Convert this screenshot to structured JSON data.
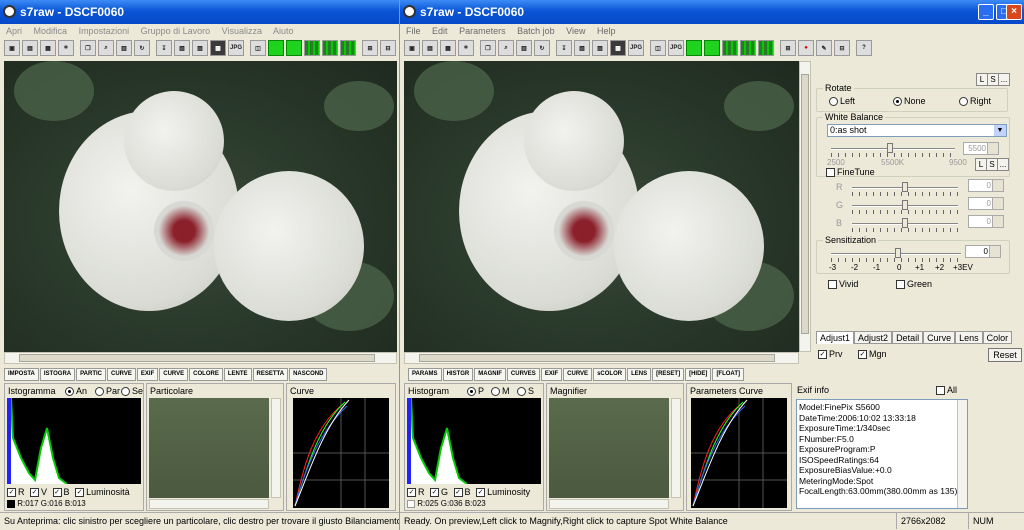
{
  "left_window": {
    "title": "s7raw - DSCF0060",
    "menu": [
      "Apri",
      "Modifica",
      "Impostazioni",
      "Gruppo di Lavoro",
      "Visualizza",
      "Aiuto"
    ],
    "tabs": [
      "IMPOSTA",
      "ISTOGRA",
      "PARTIC",
      "CURVE",
      "EXIF",
      "CURVE",
      "COLORE",
      "LENTE",
      "RESETTA",
      "NASCOND"
    ],
    "histogram_title": "Istogramma",
    "histogram_modes": [
      "An",
      "Par",
      "Se"
    ],
    "detail_title": "Particolare",
    "curve_title": "Curve",
    "channels": [
      "R",
      "V",
      "B",
      "Luminosità"
    ],
    "rgb_readout": "R:017 G:016 B:013",
    "status": "Su Anteprima: clic sinistro per scegliere un particolare, clic destro per trovare il giusto Bilanciamento del"
  },
  "right_window": {
    "title": "s7raw - DSCF0060",
    "menu": [
      "File",
      "Edit",
      "Parameters",
      "Batch job",
      "View",
      "Help"
    ],
    "tabs": [
      "PARAMS",
      "HISTGR",
      "MAGNIF",
      "CURVES",
      "EXIF",
      "CURVE",
      "sCOLOR",
      "LENS",
      "[RESET]",
      "[HIDE]",
      "[FLOAT]"
    ],
    "histogram_title": "Histogram",
    "histogram_modes": [
      "P",
      "M",
      "S"
    ],
    "magnifier_title": "Magnifier",
    "curve_title": "Parameters Curve",
    "exif_title": "Exif info",
    "exif_all": "All",
    "exif_lines": [
      "Model:FinePix S5600",
      "DateTime:2006:10:02 13:33:18",
      "ExposureTime:1/340sec",
      "FNumber:F5.0",
      "ExposureProgram:P",
      "ISOSpeedRatings:64",
      "ExposureBiasValue:+0.0",
      "MeteringMode:Spot",
      "FocalLength:63.00mm(380.00mm as 135)"
    ],
    "channels": [
      "R",
      "G",
      "B",
      "Luminosity"
    ],
    "rgb_readout": "R:025 G:036 B:023",
    "status": "Ready.  On preview,Left click to Magnify,Right click to capture Spot White Balance",
    "status_dims": "2766x2082",
    "status_num": "NUM"
  },
  "sidebar": {
    "l_button": "L",
    "s_button": "S",
    "more_button": "...",
    "rotate_label": "Rotate",
    "rotate_options": [
      "Left",
      "None",
      "Right"
    ],
    "wb_label": "White Balance",
    "wb_value": "0:as shot",
    "wb_kelvin": "5500",
    "wb_scale": [
      "2500",
      "5500K",
      "9500"
    ],
    "finetune_label": "FineTune",
    "rgb_labels": [
      "R",
      "G",
      "B"
    ],
    "rgb_values": [
      "0",
      "0",
      "0"
    ],
    "sens_label": "Sensitization",
    "sens_value": "0",
    "sens_scale": [
      "-3",
      "-2",
      "-1",
      "0",
      "+1",
      "+2",
      "+3EV"
    ],
    "vivid_label": "Vivid",
    "green_label": "Green",
    "tabs": [
      "Adjust1",
      "Adjust2",
      "Detail",
      "Curve",
      "Lens",
      "Color"
    ],
    "prv_label": "Prv",
    "mgn_label": "Mgn",
    "reset_label": "Reset"
  }
}
